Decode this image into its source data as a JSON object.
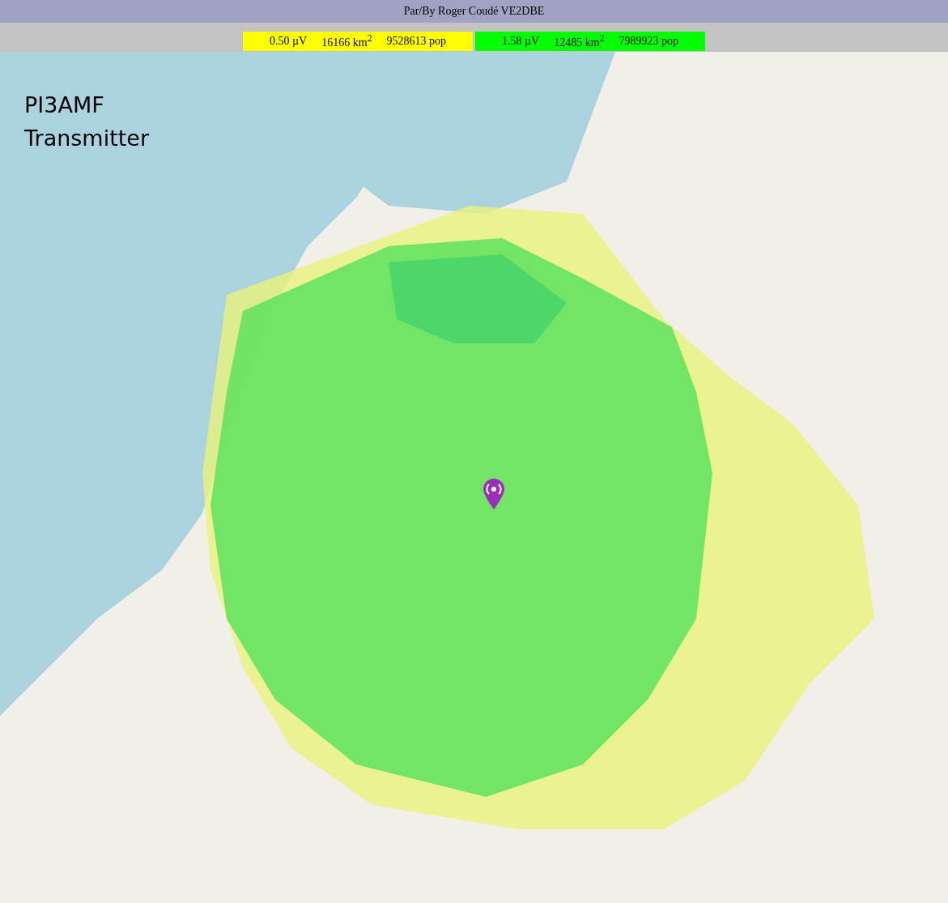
{
  "header": {
    "credit": "Par/By Roger Coudé VE2DBE"
  },
  "legend": [
    {
      "signal": "0.50 µV",
      "area": "16166 km$^{2}$",
      "population": "9528613 pop",
      "color": "#ffff00"
    },
    {
      "signal": "1.58 µV",
      "area": "12485 km$^{2}$",
      "population": "7989923 pop",
      "color": "#00ff00"
    }
  ],
  "map": {
    "title_lines": [
      "PI3AMF",
      "Transmitter"
    ]
  }
}
